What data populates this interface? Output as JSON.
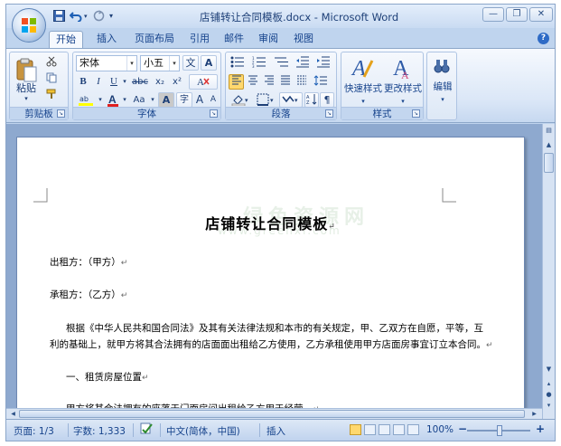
{
  "window": {
    "title": "店铺转让合同模板.docx - Microsoft Word"
  },
  "quick_access": {
    "save_icon": "save-icon",
    "undo_icon": "undo-icon",
    "redo_icon": "redo-icon"
  },
  "tabs": [
    {
      "label": "开始",
      "active": true
    },
    {
      "label": "插入"
    },
    {
      "label": "页面布局"
    },
    {
      "label": "引用"
    },
    {
      "label": "邮件"
    },
    {
      "label": "审阅"
    },
    {
      "label": "视图"
    }
  ],
  "ribbon": {
    "clipboard": {
      "paste_label": "粘贴",
      "group_label": "剪贴板"
    },
    "font": {
      "font_name": "宋体",
      "font_size": "小五",
      "bold": "B",
      "italic": "I",
      "underline": "U",
      "strike": "abc",
      "subscript": "x₂",
      "superscript": "x²",
      "font_color_glyph": "A",
      "change_case": "Aa",
      "char_shading": "A",
      "enclose": "字",
      "grow": "A",
      "shrink": "A",
      "phonetic": "文",
      "border_char": "A",
      "group_label": "字体"
    },
    "paragraph": {
      "group_label": "段落"
    },
    "styles": {
      "quick_styles_label": "快速样式",
      "change_styles_label": "更改样式",
      "group_label": "样式"
    },
    "editing": {
      "label": "编辑"
    }
  },
  "document": {
    "title": "店铺转让合同模板",
    "lines": [
      "出租方：（甲方）",
      "承租方：（乙方）",
      "根据《中华人民共和国合同法》及其有关法律法规和本市的有关规定，甲、乙双方在自愿，平等，互",
      "利的基础上，就甲方将其合法拥有的店面面出租给乙方使用，乙方承租使用甲方店面房事宜订立本合同。",
      "一、租赁房屋位置",
      "甲方将其合法拥有的座落于门面房间出租给乙方用于经营。"
    ],
    "paragraph_mark": "↵",
    "watermark": "绿色资源网",
    "watermark_url": "www.greenxf.com"
  },
  "status_bar": {
    "page": "页面: 1/3",
    "words": "字数: 1,333",
    "language": "中文(简体，中国)",
    "mode": "插入",
    "zoom": "100%",
    "zoom_level": 100
  },
  "colors": {
    "ribbon_blue": "#bfd4ee",
    "active_view": "#ffd86e"
  }
}
